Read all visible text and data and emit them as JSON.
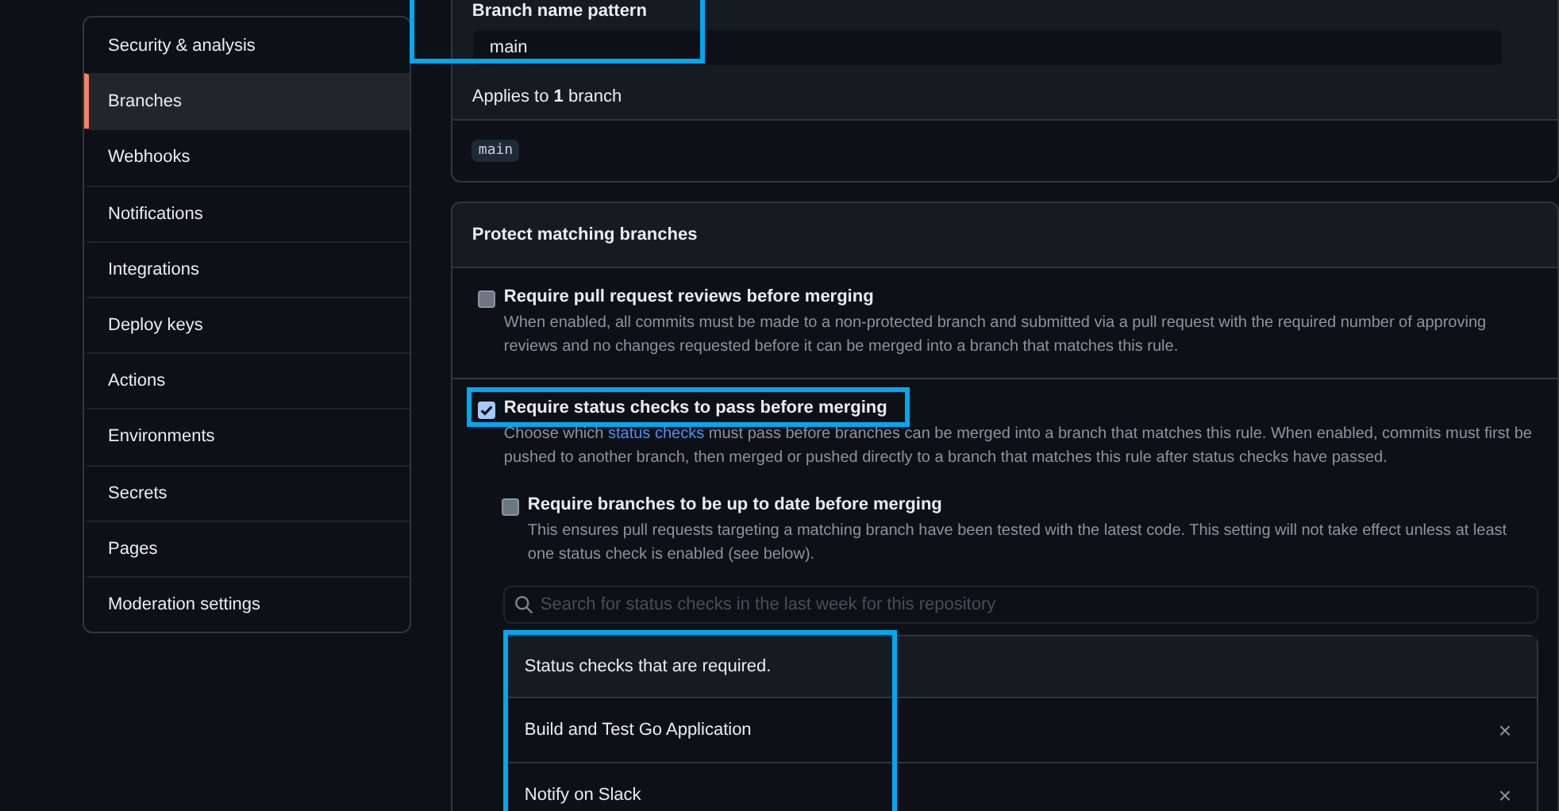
{
  "sidebar": {
    "items": [
      {
        "label": "Security & analysis",
        "selected": false
      },
      {
        "label": "Branches",
        "selected": true
      },
      {
        "label": "Webhooks",
        "selected": false
      },
      {
        "label": "Notifications",
        "selected": false
      },
      {
        "label": "Integrations",
        "selected": false
      },
      {
        "label": "Deploy keys",
        "selected": false
      },
      {
        "label": "Actions",
        "selected": false
      },
      {
        "label": "Environments",
        "selected": false
      },
      {
        "label": "Secrets",
        "selected": false
      },
      {
        "label": "Pages",
        "selected": false
      },
      {
        "label": "Moderation settings",
        "selected": false
      }
    ]
  },
  "branch_pattern": {
    "label": "Branch name pattern",
    "value": "main",
    "highlighted": true,
    "applies": "Applies to **1** branch",
    "branches": [
      "main"
    ]
  },
  "protect": {
    "title": "Protect matching branches",
    "rules": [
      {
        "title": "Require pull request reviews before merging",
        "checked": false,
        "description": "When enabled, all commits must be made to a non-protected branch and submitted via a pull request with the required number of approving reviews and no changes requested before it can be merged into a branch that matches this rule."
      },
      {
        "title": "Require status checks to pass before merging",
        "checked": true,
        "highlighted": true,
        "description_before": "Choose which ",
        "link": "status checks",
        "description": " must pass before branches can be merged into a branch that matches this rule. When enabled, commits must first be pushed to another branch, then merged or pushed directly to a branch that matches this rule after status checks have passed.",
        "sub_rules": [
          {
            "title": "Require branches to be up to date before merging",
            "checked": false,
            "description": "This ensures pull requests targeting a matching branch have been tested with the latest code. This setting will not take effect unless at least one status check is enabled (see below)."
          }
        ],
        "status_checks": {
          "highlighted": true,
          "search_placeholder": "Search for status checks in the last week for this repository",
          "header": "Status checks that are required.",
          "items": [
            {
              "name": "Build and Test Go Application",
              "remove": "×"
            },
            {
              "name": "Notify on Slack",
              "remove": "×"
            }
          ]
        }
      }
    ]
  }
}
